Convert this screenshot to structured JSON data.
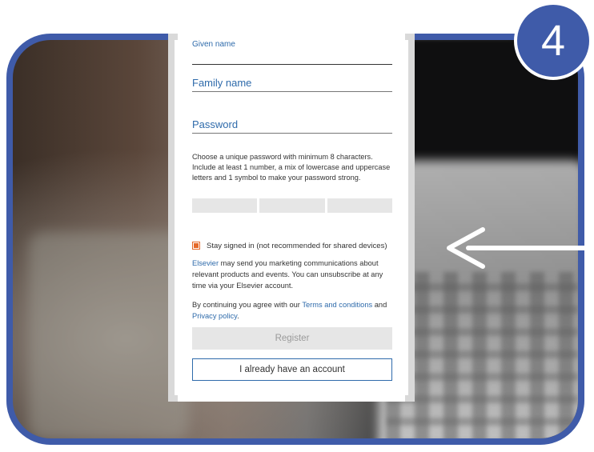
{
  "step_badge": "4",
  "form": {
    "given_name_label": "Given name",
    "family_name_label": "Family name",
    "password_label": "Password",
    "password_hint": "Choose a unique password with minimum 8 characters. Include at least 1 number, a mix of lowercase and uppercase letters and 1 symbol to make your password strong.",
    "stay_signed_in_label": "Stay signed in (not recommended for shared devices)",
    "marketing": {
      "brand_link": "Elsevier",
      "text": " may send you marketing communications about relevant products and events. You can unsubscribe at any time via your Elsevier account."
    },
    "agreement": {
      "prefix": "By continuing you agree with our ",
      "terms_link": "Terms and conditions",
      "middle": " and ",
      "privacy_link": "Privacy policy",
      "suffix": "."
    },
    "register_button": "Register",
    "login_button": "I already have an account"
  },
  "colors": {
    "frame": "#3f5ba9",
    "link": "#2f6bab",
    "checkbox": "#e56a2a"
  },
  "icons": {
    "arrow": "arrow-left-icon",
    "checkbox": "checkbox-checked-icon"
  }
}
